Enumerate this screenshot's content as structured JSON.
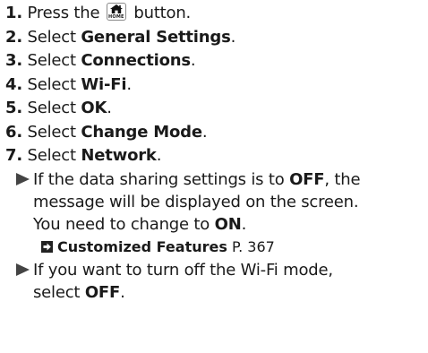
{
  "steps": [
    {
      "num": "1.",
      "pre": "Press the ",
      "icon": "home-icon",
      "icon_text": "HOME",
      "post": " button."
    },
    {
      "num": "2.",
      "pre": "Select ",
      "bold": "General Settings",
      "post": "."
    },
    {
      "num": "3.",
      "pre": "Select ",
      "bold": "Connections",
      "post": "."
    },
    {
      "num": "4.",
      "pre": "Select ",
      "bold": "Wi-Fi",
      "post": "."
    },
    {
      "num": "5.",
      "pre": "Select ",
      "bold": "OK",
      "post": "."
    },
    {
      "num": "6.",
      "pre": "Select ",
      "bold": "Change Mode",
      "post": "."
    },
    {
      "num": "7.",
      "pre": "Select ",
      "bold": "Network",
      "post": "."
    }
  ],
  "notes": [
    {
      "icon": "triangle-bullet-icon",
      "line1_pre": "If the data sharing settings is to ",
      "line1_bold": "OFF",
      "line1_post": ", the",
      "line2": "message will be displayed on the screen.",
      "line3_pre": "You need to change to ",
      "line3_bold": "ON",
      "line3_post": "."
    },
    {
      "icon": "triangle-bullet-icon",
      "line1": "If you want to turn off the Wi-Fi mode,",
      "line2_pre": "select ",
      "line2_bold": "OFF",
      "line2_post": "."
    }
  ],
  "xref": {
    "icon": "cross-reference-arrow-icon",
    "title": "Customized Features",
    "page": "P. 367"
  }
}
